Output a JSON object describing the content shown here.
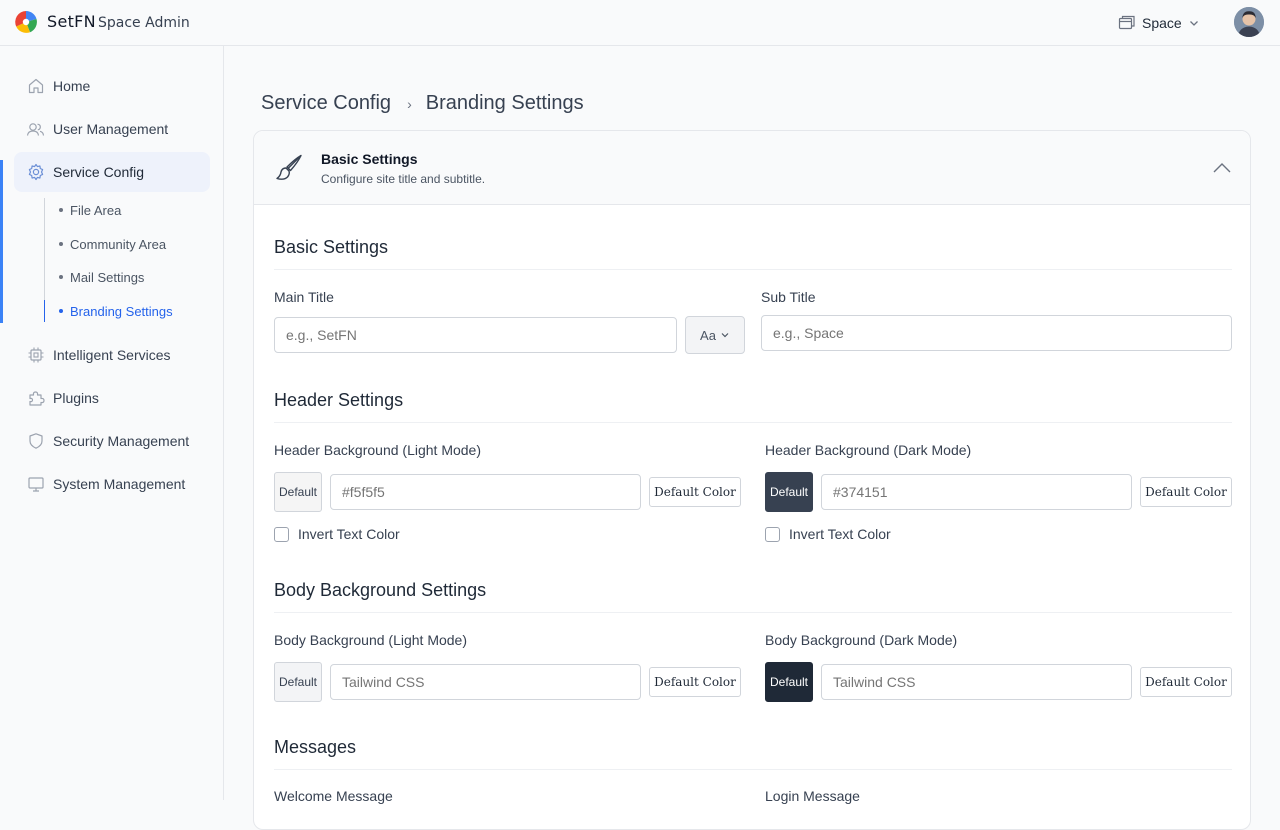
{
  "header": {
    "brand": "SetFN",
    "brand_sub": "Space Admin",
    "space_label": "Space"
  },
  "sidebar": {
    "items": [
      {
        "label": "Home",
        "icon": "home-icon"
      },
      {
        "label": "User Management",
        "icon": "users-icon"
      },
      {
        "label": "Service Config",
        "icon": "gear-icon",
        "active": true
      },
      {
        "label": "Intelligent Services",
        "icon": "chip-icon"
      },
      {
        "label": "Plugins",
        "icon": "puzzle-icon"
      },
      {
        "label": "Security Management",
        "icon": "shield-icon"
      },
      {
        "label": "System Management",
        "icon": "monitor-icon"
      }
    ],
    "sub_items": [
      {
        "label": "File Area"
      },
      {
        "label": "Community Area"
      },
      {
        "label": "Mail Settings"
      },
      {
        "label": "Branding Settings",
        "active": true
      }
    ]
  },
  "breadcrumb": {
    "parent": "Service Config",
    "separator": "›",
    "current": "Branding Settings"
  },
  "card": {
    "title": "Basic Settings",
    "subtitle": "Configure site title and subtitle."
  },
  "basic": {
    "section_title": "Basic Settings",
    "main_title_label": "Main Title",
    "main_title_placeholder": "e.g., SetFN",
    "font_button": "Aa",
    "sub_title_label": "Sub Title",
    "sub_title_placeholder": "e.g., Space"
  },
  "header_settings": {
    "section_title": "Header Settings",
    "light_label": "Header Background (Light Mode)",
    "light_swatch": "Default",
    "light_value": "#f5f5f5",
    "light_default_btn": "Default Color",
    "light_invert": "Invert Text Color",
    "dark_label": "Header Background (Dark Mode)",
    "dark_swatch": "Default",
    "dark_value": "#374151",
    "dark_default_btn": "Default Color",
    "dark_invert": "Invert Text Color"
  },
  "body_settings": {
    "section_title": "Body Background Settings",
    "light_label": "Body Background (Light Mode)",
    "light_swatch": "Default",
    "light_placeholder": "Tailwind CSS",
    "light_default_btn": "Default Color",
    "dark_label": "Body Background (Dark Mode)",
    "dark_swatch": "Default",
    "dark_placeholder": "Tailwind CSS",
    "dark_default_btn": "Default Color"
  },
  "messages": {
    "section_title": "Messages",
    "welcome_label": "Welcome Message",
    "login_label": "Login Message"
  },
  "colors": {
    "accent": "#3b82f6",
    "header_light": "#f5f5f5",
    "header_dark": "#374151",
    "body_dark": "#1f2937"
  }
}
